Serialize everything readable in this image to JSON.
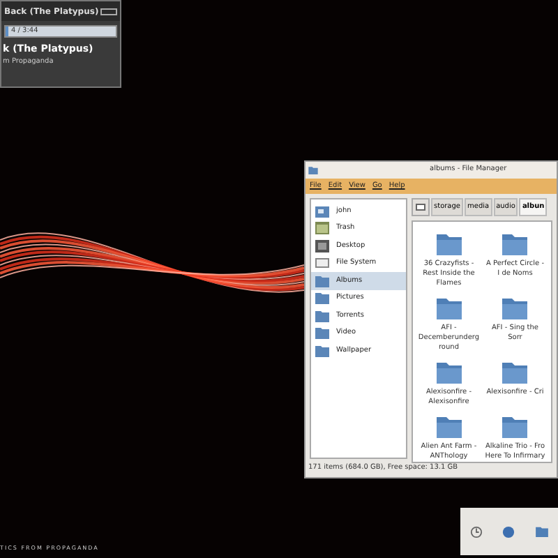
{
  "player": {
    "title": "Back (The Platypus)",
    "time": "4 / 3:44",
    "level": 0.03,
    "track": "k (The Platypus)",
    "artist": "m Propaganda"
  },
  "desktop_caption": "TICS FROM PROPAGANDA",
  "file_manager": {
    "title": "albums - File Manager",
    "menu": [
      "File",
      "Edit",
      "View",
      "Go",
      "Help"
    ],
    "sidebar": [
      {
        "label": "john",
        "kind": "home",
        "selected": false
      },
      {
        "label": "Trash",
        "kind": "trash",
        "selected": false
      },
      {
        "label": "Desktop",
        "kind": "desktop",
        "selected": false
      },
      {
        "label": "File System",
        "kind": "drive",
        "selected": false
      },
      {
        "label": "Albums",
        "kind": "folder",
        "selected": true
      },
      {
        "label": "Pictures",
        "kind": "folder",
        "selected": false
      },
      {
        "label": "Torrents",
        "kind": "folder",
        "selected": false
      },
      {
        "label": "Video",
        "kind": "folder",
        "selected": false
      },
      {
        "label": "Wallpaper",
        "kind": "folder",
        "selected": false
      }
    ],
    "path": [
      {
        "label": "storage",
        "selected": false
      },
      {
        "label": "media",
        "selected": false
      },
      {
        "label": "audio",
        "selected": false
      },
      {
        "label": "albun",
        "selected": true
      }
    ],
    "items": [
      "36 Crazyfists - Rest Inside the Flames",
      "A Perfect Circle - I de Noms",
      "AFI - Decemberunderground",
      "AFI - Sing the Sorr",
      "Alexisonfire - Alexisonfire",
      "Alexisonfire - Cri",
      "Alien Ant Farm - ANThology",
      "Alkaline Trio - Fro Here To Infirmary"
    ],
    "status": "171 items (684.0 GB), Free space: 13.1 GB"
  }
}
